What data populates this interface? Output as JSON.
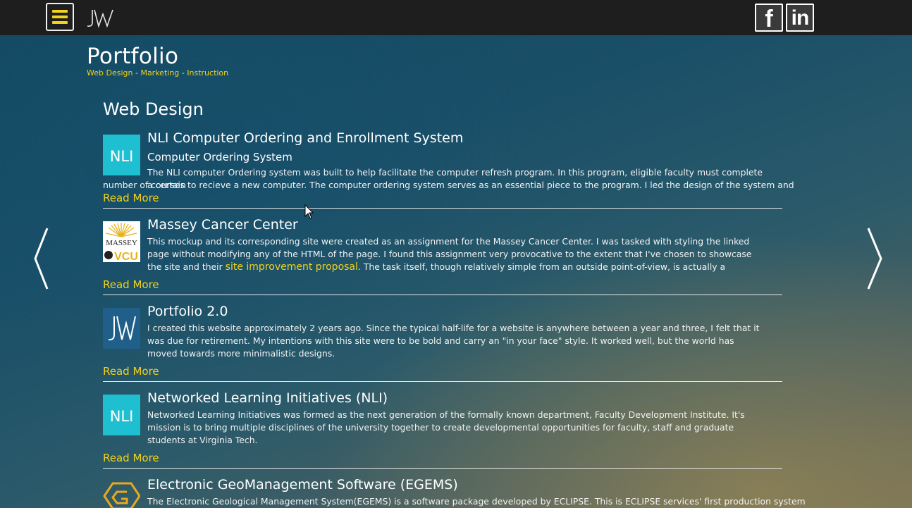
{
  "header": {
    "logo_text": "JW",
    "menu_icon": "hamburger-icon",
    "social": [
      {
        "name": "facebook",
        "glyph": "f"
      },
      {
        "name": "linkedin",
        "glyph": "in"
      }
    ]
  },
  "page": {
    "title": "Portfolio",
    "subnav": [
      "Web Design",
      "Marketing",
      "Instruction"
    ],
    "subnav_separator": "-"
  },
  "section": {
    "title": "Web Design"
  },
  "entries": [
    {
      "title": "NLI Computer Ordering and Enrollment System",
      "subtitle": "Computer Ordering System",
      "description_line1": "The NLI computer Ordering system was built to help facilitate the computer refresh program. In this program, eligible faculty must complete a certain",
      "description_rest": "number of courses to recieve a new computer. The computer ordering system serves as an essential piece to the program. I led the design of the system and",
      "read_more": "Read More",
      "thumb": "NLI"
    },
    {
      "title": "Massey Cancer Center",
      "description_a": "This mockup and its corresponding site were created as an assignment for the Massey Cancer Center. I was tasked with styling the linked page without modifying any of the HTML of the page. I found this assignment very provocative to the extent that I've chosen to showcase the site and their ",
      "link_text": "site improvement proposal",
      "description_b": ". The task itself, though relatively simple from an outside point-of-view, is actually a complex issue that many web",
      "read_more": "Read More",
      "thumb_top": "MASSEY",
      "thumb_bottom": "VCU"
    },
    {
      "title": "Portfolio 2.0",
      "description": "I created this website approximately 2 years ago. Since the typical half-life for a website is anywhere between a year and three, I felt that it was due for retirement. My intentions with this site were to be bold and carry an \"in your face\" style. It worked well, but the world has moved towards more minimalistic designs.",
      "read_more": "Read More",
      "thumb": "JW"
    },
    {
      "title": "Networked Learning Initiatives (NLI)",
      "description": "Networked Learning Initiatives was formed as the next generation of the formally known department, Faculty Development Institute. It's mission is to bring multiple disciplines of the university together to create developmental opportunities for faculty, staff and graduate students at Virginia Tech.",
      "read_more": "Read More",
      "thumb": "NLI"
    },
    {
      "title": "Electronic GeoManagement Software (EGEMS)",
      "description": "The Electronic Geological Management System(EGEMS) is a software package developed by ECLIPSE. This is ECLIPSE services' first production system",
      "thumb": "egems-logo"
    }
  ],
  "colors": {
    "accent": "#f2d21b",
    "topbar": "#1e1e1e",
    "nli_tile": "#1ebfd0",
    "jw_tile": "#1f5f8a"
  }
}
